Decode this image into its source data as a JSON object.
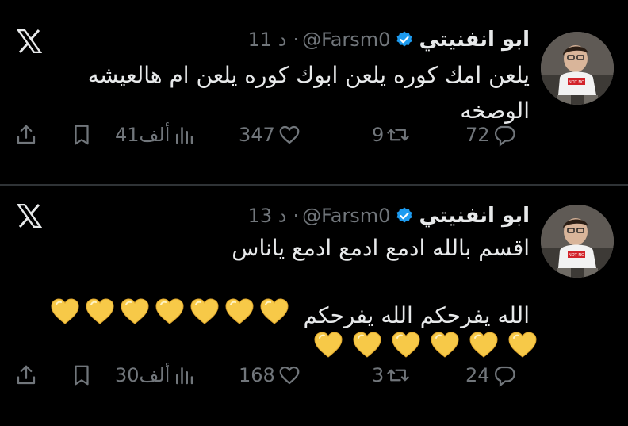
{
  "tweets": [
    {
      "name": "ابو انفنيتي",
      "handle": "@Farsm0",
      "time": "11 د",
      "dot": "·",
      "text_lines": [
        "يلعن امك كوره يلعن ابوك كوره يلعن ام هالعيشه",
        "الوصخه"
      ],
      "replies": "72",
      "retweets": "9",
      "likes": "347",
      "views": "41ألف"
    },
    {
      "name": "ابو انفنيتي",
      "handle": "@Farsm0",
      "time": "13 د",
      "dot": "·",
      "text_lines": [
        "اقسم بالله ادمع ادمع ادمع ياناس",
        "الله يفرحكم الله يفرحكم"
      ],
      "replies": "24",
      "retweets": "3",
      "likes": "168",
      "views": "30ألف"
    }
  ],
  "colors": {
    "background": "#000000",
    "text": "#e7e9ea",
    "muted": "#71767b",
    "verified": "#1d9bf0",
    "heart": "#f7c948"
  },
  "icons": {
    "logo": "x-logo-icon",
    "verified": "verified-badge-icon",
    "reply": "reply-icon",
    "retweet": "retweet-icon",
    "like": "heart-icon",
    "views": "views-icon",
    "bookmark": "bookmark-icon",
    "share": "share-icon",
    "emoji": "yellow-heart-emoji"
  }
}
